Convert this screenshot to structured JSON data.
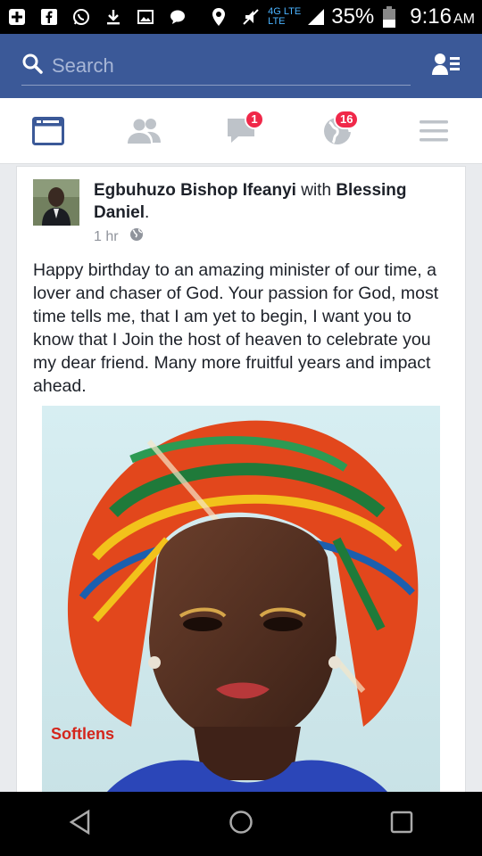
{
  "status_bar": {
    "network_top": "4G LTE",
    "network_bottom": "LTE",
    "battery": "35%",
    "time": "9:16",
    "ampm": "AM"
  },
  "search": {
    "placeholder": "Search"
  },
  "nav": {
    "messages_badge": "1",
    "notifications_badge": "16"
  },
  "post": {
    "author": "Egbuhuzo Bishop Ifeanyi",
    "with_word": "with",
    "tagged": "Blessing Daniel",
    "time": "1 hr",
    "text": "Happy birthday to an amazing minister of our time, a lover and chaser of God. Your passion for God, most time tells me, that I am yet to begin, I want you to know that I Join the host of heaven to celebrate you my dear friend. Many more fruitful years and impact ahead.",
    "photo_watermark": "Softlens"
  },
  "colors": {
    "brand": "#3b5998",
    "badge": "#f02849"
  }
}
